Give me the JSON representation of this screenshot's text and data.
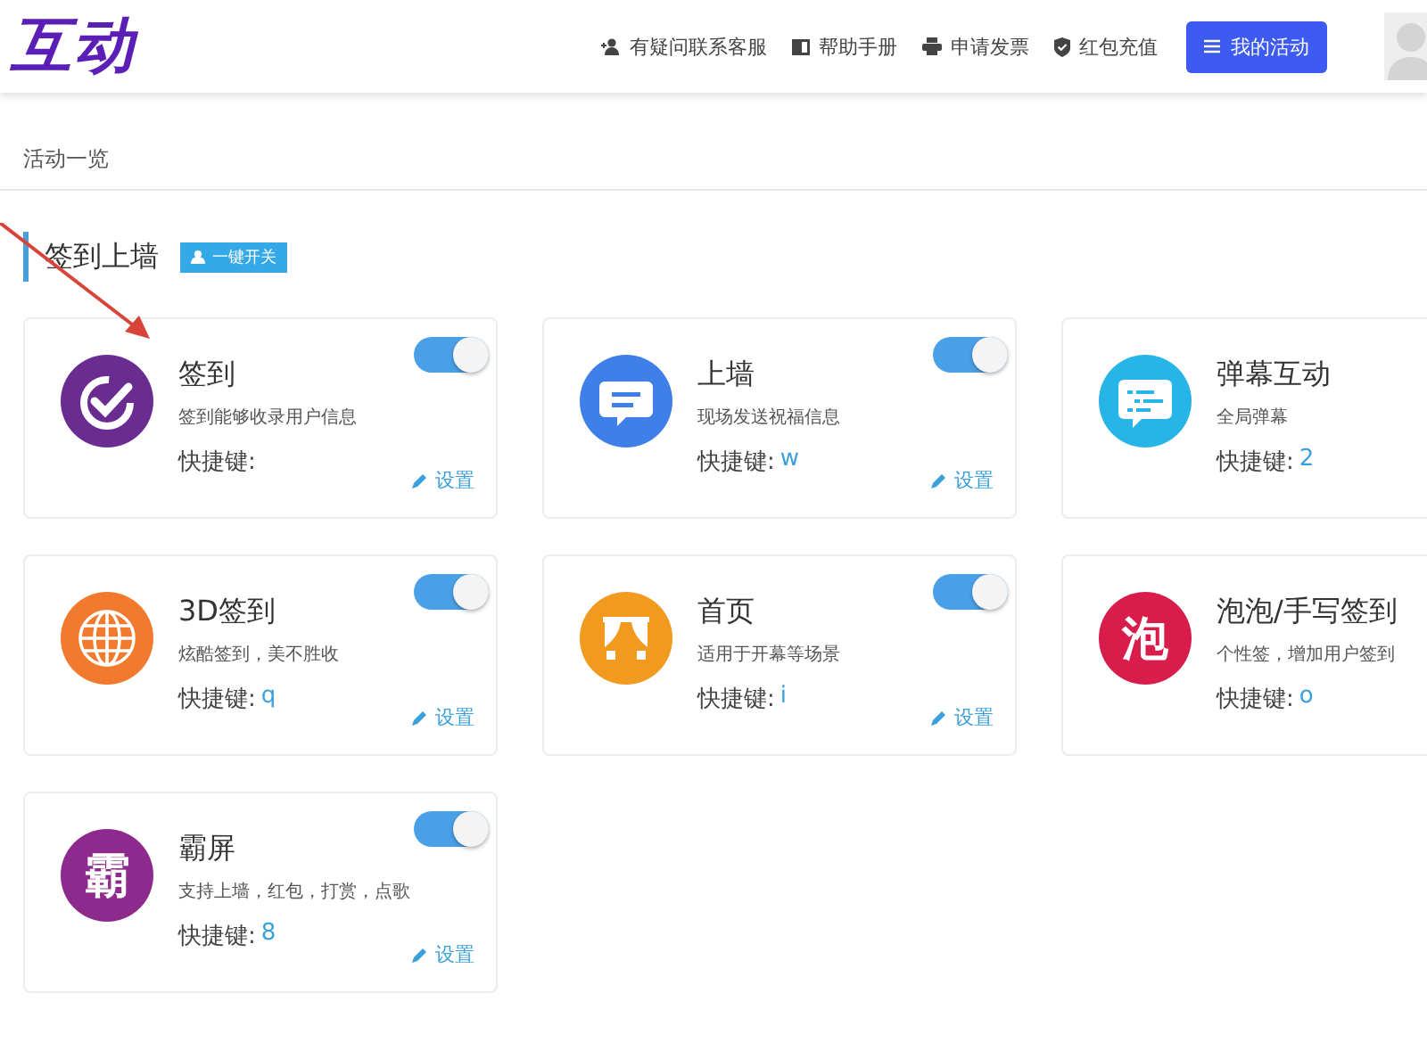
{
  "header": {
    "logo": "互动",
    "links": [
      "有疑问联系客服",
      "帮助手册",
      "申请发票",
      "红包充值"
    ],
    "primary_button": "我的活动"
  },
  "breadcrumb": "活动一览",
  "section": {
    "title": "签到上墙",
    "toggle_all_button": "一键开关"
  },
  "cards": [
    {
      "kind": "check",
      "color": "#6a2c91",
      "title": "签到",
      "desc": "签到能够收录用户信息",
      "shortcut_label": "快捷键:",
      "on": true,
      "settings": "设置"
    },
    {
      "kind": "message",
      "color": "#3f7fe8",
      "title": "上墙",
      "desc": "现场发送祝福信息",
      "shortcut_label": "快捷键:",
      "shortcut": "w",
      "on": true,
      "settings": "设置"
    },
    {
      "kind": "list",
      "color": "#27b5e8",
      "title": "弹幕互动",
      "desc": "全局弹幕",
      "shortcut_label": "快捷键:",
      "shortcut": "2"
    },
    {
      "kind": "globe",
      "color": "#f27a2e",
      "title": "3D签到",
      "desc": "炫酷签到，美不胜收",
      "shortcut_label": "快捷键:",
      "shortcut": "q",
      "on": true,
      "settings": "设置"
    },
    {
      "kind": "curtain",
      "color": "#f29a1f",
      "title": "首页",
      "desc": "适用于开幕等场景",
      "shortcut_label": "快捷键:",
      "shortcut": "i",
      "on": true,
      "settings": "设置"
    },
    {
      "kind": "glyph",
      "color": "#d81d4a",
      "glyph": "泡",
      "title": "泡泡/手写签到",
      "desc": "个性签，增加用户签到",
      "shortcut_label": "快捷键:",
      "shortcut": "o"
    },
    {
      "kind": "glyph",
      "color": "#8e2a8e",
      "glyph": "霸",
      "title": "霸屏",
      "desc": "支持上墙，红包，打赏，点歌",
      "shortcut_label": "快捷键:",
      "shortcut": "8",
      "on": true,
      "settings": "设置"
    }
  ]
}
